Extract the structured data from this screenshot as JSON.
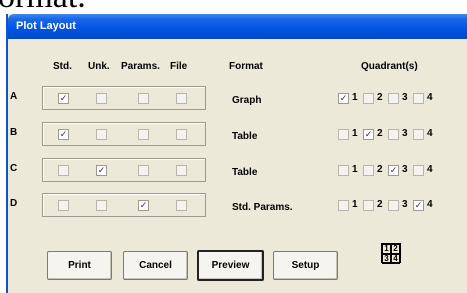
{
  "background": {
    "text": "ormat."
  },
  "window": {
    "title": "Plot Layout"
  },
  "headers": {
    "std": "Std.",
    "unk": "Unk.",
    "params": "Params.",
    "file": "File",
    "format": "Format",
    "quadrants": "Quadrant(s)"
  },
  "rows": [
    {
      "label": "A",
      "format": "Graph",
      "std": true,
      "unk": false,
      "params": false,
      "file": false,
      "q1": true,
      "q2": false,
      "q3": false,
      "q4": false
    },
    {
      "label": "B",
      "format": "Table",
      "std": true,
      "unk": false,
      "params": false,
      "file": false,
      "q1": false,
      "q2": true,
      "q3": false,
      "q4": false
    },
    {
      "label": "C",
      "format": "Table",
      "std": false,
      "unk": true,
      "params": false,
      "file": false,
      "q1": false,
      "q2": false,
      "q3": true,
      "q4": false
    },
    {
      "label": "D",
      "format": "Std. Params.",
      "std": false,
      "unk": false,
      "params": true,
      "file": false,
      "q1": false,
      "q2": false,
      "q3": false,
      "q4": true
    }
  ],
  "quadrant_numbers": [
    "1",
    "2",
    "3",
    "4"
  ],
  "buttons": {
    "print": "Print",
    "cancel": "Cancel",
    "preview": "Preview",
    "setup": "Setup"
  }
}
